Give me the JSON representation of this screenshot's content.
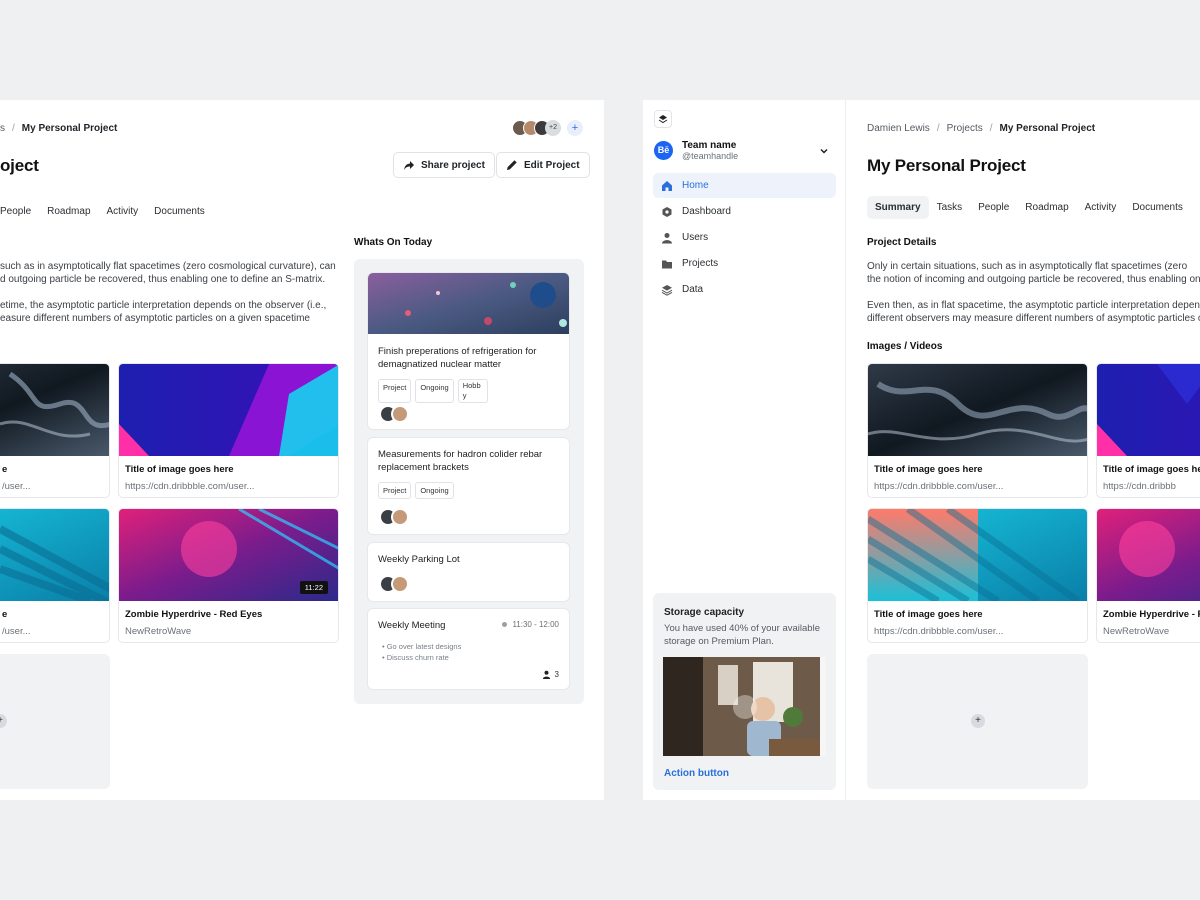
{
  "left_panel": {
    "breadcrumb_prev": "s",
    "breadcrumb_current": "My Personal Project",
    "title_visible": "oject",
    "avatar_more": "+2",
    "share_label": "Share project",
    "edit_label": "Edit Project",
    "tabs": [
      "People",
      "Roadmap",
      "Activity",
      "Documents"
    ],
    "para1_line1": "such as in asymptotically flat spacetimes (zero cosmological curvature), can",
    "para1_line2": "d outgoing particle be recovered, thus enabling one to define an S-matrix.",
    "para2_line1": "etime, the asymptotic particle interpretation depends on the observer (i.e.,",
    "para2_line2": "easure different numbers of asymptotic particles on a given spacetime",
    "cards": [
      {
        "title": "e",
        "url": "/user..."
      },
      {
        "title": "Title of image goes here",
        "url": "https://cdn.dribbble.com/user..."
      },
      {
        "title": "e",
        "url": "/user..."
      },
      {
        "title": "Zombie Hyperdrive - Red Eyes",
        "url": "NewRetroWave",
        "duration": "11:22"
      }
    ],
    "today": {
      "heading": "Whats On Today",
      "items": [
        {
          "title_l1": "Finish preperations of refrigeration for",
          "title_l2": "demagnatized nuclear matter",
          "tags": [
            "Project",
            "Ongoing",
            "Hobb y"
          ]
        },
        {
          "title_l1": "Measurements for hadron colider rebar",
          "title_l2": "replacement brackets",
          "tags": [
            "Project",
            "Ongoing"
          ]
        },
        {
          "title_l1": "Weekly Parking Lot"
        },
        {
          "title_l1": "Weekly Meeting",
          "time": "11:30 - 12:00",
          "bullets": [
            "Go over latest designs",
            "Discuss churn rate"
          ],
          "attendees": "3"
        }
      ]
    }
  },
  "right_panel": {
    "team_name": "Team name",
    "team_handle": "@teamhandle",
    "team_logo": "Bē",
    "nav": [
      {
        "label": "Home",
        "icon": "home-icon",
        "active": true
      },
      {
        "label": "Dashboard",
        "icon": "hexagon-icon"
      },
      {
        "label": "Users",
        "icon": "user-icon"
      },
      {
        "label": "Projects",
        "icon": "folder-icon"
      },
      {
        "label": "Data",
        "icon": "layers-icon"
      }
    ],
    "storage": {
      "title": "Storage capacity",
      "text_l1": "You have used 40% of your available",
      "text_l2": "storage on Premium Plan.",
      "action": "Action button"
    },
    "breadcrumb": [
      "Damien Lewis",
      "Projects",
      "My Personal Project"
    ],
    "title": "My Personal Project",
    "tabs": [
      "Summary",
      "Tasks",
      "People",
      "Roadmap",
      "Activity",
      "Documents"
    ],
    "details_heading": "Project Details",
    "para1_line1": "Only in certain situations, such as in asymptotically flat spacetimes (zero",
    "para1_line2": "the notion of incoming and outgoing particle be recovered, thus enabling one",
    "para2_line1": " Even then, as in flat spacetime, the asymptotic particle interpretation depend",
    "para2_line2": "different observers may measure different numbers of asymptotic particles o",
    "media_heading": "Images / Videos",
    "cards": [
      {
        "title": "Title of image goes here",
        "url": "https://cdn.dribbble.com/user..."
      },
      {
        "title": "Title of image goes he",
        "url": "https://cdn.dribbb"
      },
      {
        "title": "Title of image goes here",
        "url": "https://cdn.dribbble.com/user..."
      },
      {
        "title": "Zombie Hyperdrive - R",
        "url": "NewRetroWave"
      }
    ]
  },
  "colors": {
    "accent": "#2a6fdb",
    "page_bg": "#eef0f2"
  }
}
